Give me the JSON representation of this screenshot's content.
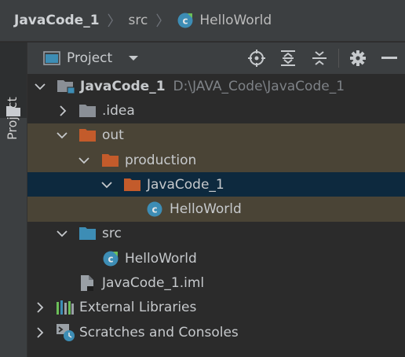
{
  "breadcrumb": {
    "project": "JavaCode_1",
    "folder": "src",
    "file": "HelloWorld"
  },
  "stripe": {
    "tab_label": "Project"
  },
  "panel": {
    "view_label": "Project",
    "tools": [
      "locate-icon",
      "expand-all-icon",
      "collapse-all-icon",
      "gear-icon",
      "minimize-icon"
    ]
  },
  "tree": {
    "root": {
      "name": "JavaCode_1",
      "path": "D:\\JAVA_Code\\JavaCode_1"
    },
    "idea": ".idea",
    "out": "out",
    "production": "production",
    "prod_module": "JavaCode_1",
    "out_class": "HelloWorld",
    "src": "src",
    "src_class": "HelloWorld",
    "iml": "JavaCode_1.iml",
    "external": "External Libraries",
    "scratches": "Scratches and Consoles"
  },
  "colors": {
    "excluded_folder": "#c35b2b",
    "source_folder": "#3d8db5",
    "plain_folder": "#8a8f96",
    "class_icon": "#3d8db5",
    "selected_row": "#0d293e",
    "excluded_row": "#4a4436"
  }
}
